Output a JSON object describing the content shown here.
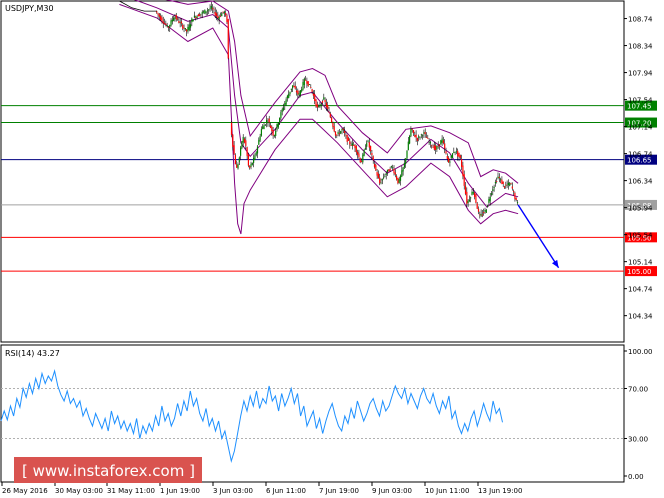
{
  "chart_data": [
    {
      "type": "candlestick",
      "title": "USDJPY,M30",
      "y_ticks": [
        "108.74",
        "108.34",
        "107.94",
        "107.54",
        "107.14",
        "106.74",
        "106.34",
        "105.94",
        "105.54",
        "105.14",
        "104.74",
        "104.34"
      ],
      "ylim": [
        103.95,
        109.0
      ],
      "x_ticks": [
        "26 May 2016",
        "30 May 03:00",
        "31 May 11:00",
        "1 Jun 19:00",
        "3 Jun 03:00",
        "6 Jun 11:00",
        "7 Jun 19:00",
        "9 Jun 03:00",
        "10 Jun 11:00",
        "13 Jun 19:00"
      ],
      "price_path": [
        [
          0.0,
          109.05
        ],
        [
          0.04,
          109.02
        ],
        [
          0.08,
          109.05
        ],
        [
          0.12,
          109.0
        ],
        [
          0.19,
          109.0
        ],
        [
          0.21,
          108.9
        ],
        [
          0.23,
          108.85
        ],
        [
          0.25,
          108.85
        ],
        [
          0.27,
          108.6
        ],
        [
          0.28,
          108.78
        ],
        [
          0.3,
          108.55
        ],
        [
          0.31,
          108.75
        ],
        [
          0.33,
          108.85
        ],
        [
          0.34,
          108.9
        ],
        [
          0.35,
          108.75
        ],
        [
          0.36,
          108.85
        ],
        [
          0.365,
          108.7
        ],
        [
          0.37,
          107.2
        ],
        [
          0.375,
          106.8
        ],
        [
          0.38,
          106.5
        ],
        [
          0.385,
          106.7
        ],
        [
          0.39,
          107.0
        ],
        [
          0.395,
          106.85
        ],
        [
          0.4,
          106.5
        ],
        [
          0.41,
          106.7
        ],
        [
          0.42,
          107.1
        ],
        [
          0.43,
          107.25
        ],
        [
          0.44,
          107.0
        ],
        [
          0.45,
          107.3
        ],
        [
          0.46,
          107.55
        ],
        [
          0.47,
          107.75
        ],
        [
          0.48,
          107.6
        ],
        [
          0.49,
          107.85
        ],
        [
          0.5,
          107.7
        ],
        [
          0.51,
          107.4
        ],
        [
          0.52,
          107.55
        ],
        [
          0.53,
          107.3
        ],
        [
          0.54,
          107.0
        ],
        [
          0.55,
          107.1
        ],
        [
          0.56,
          106.9
        ],
        [
          0.57,
          106.85
        ],
        [
          0.58,
          106.6
        ],
        [
          0.59,
          106.95
        ],
        [
          0.6,
          106.6
        ],
        [
          0.61,
          106.3
        ],
        [
          0.62,
          106.45
        ],
        [
          0.63,
          106.55
        ],
        [
          0.64,
          106.3
        ],
        [
          0.65,
          106.6
        ],
        [
          0.66,
          107.1
        ],
        [
          0.67,
          106.95
        ],
        [
          0.68,
          107.05
        ],
        [
          0.69,
          106.9
        ],
        [
          0.7,
          106.8
        ],
        [
          0.71,
          106.95
        ],
        [
          0.72,
          106.6
        ],
        [
          0.73,
          106.8
        ],
        [
          0.74,
          106.65
        ],
        [
          0.75,
          106.0
        ],
        [
          0.76,
          106.2
        ],
        [
          0.77,
          105.8
        ],
        [
          0.78,
          105.9
        ],
        [
          0.79,
          106.2
        ],
        [
          0.8,
          106.4
        ],
        [
          0.81,
          106.25
        ],
        [
          0.82,
          106.3
        ],
        [
          0.83,
          106.0
        ]
      ],
      "bb_mid": [
        [
          0.19,
          109.1
        ],
        [
          0.25,
          108.9
        ],
        [
          0.3,
          108.7
        ],
        [
          0.34,
          108.8
        ],
        [
          0.365,
          108.6
        ],
        [
          0.375,
          107.6
        ],
        [
          0.385,
          106.9
        ],
        [
          0.4,
          106.7
        ],
        [
          0.44,
          107.1
        ],
        [
          0.48,
          107.6
        ],
        [
          0.5,
          107.65
        ],
        [
          0.54,
          107.2
        ],
        [
          0.58,
          106.8
        ],
        [
          0.62,
          106.45
        ],
        [
          0.65,
          106.6
        ],
        [
          0.69,
          106.95
        ],
        [
          0.72,
          106.75
        ],
        [
          0.75,
          106.3
        ],
        [
          0.78,
          105.95
        ],
        [
          0.81,
          106.15
        ],
        [
          0.83,
          106.1
        ]
      ],
      "bb_upper": [
        [
          0.19,
          109.2
        ],
        [
          0.25,
          109.05
        ],
        [
          0.3,
          108.95
        ],
        [
          0.34,
          109.0
        ],
        [
          0.365,
          108.85
        ],
        [
          0.375,
          108.4
        ],
        [
          0.385,
          107.6
        ],
        [
          0.4,
          107.0
        ],
        [
          0.44,
          107.5
        ],
        [
          0.48,
          107.95
        ],
        [
          0.5,
          108.0
        ],
        [
          0.52,
          107.9
        ],
        [
          0.54,
          107.45
        ],
        [
          0.58,
          107.05
        ],
        [
          0.62,
          106.75
        ],
        [
          0.65,
          107.1
        ],
        [
          0.69,
          107.15
        ],
        [
          0.72,
          107.05
        ],
        [
          0.75,
          106.9
        ],
        [
          0.77,
          106.4
        ],
        [
          0.79,
          106.5
        ],
        [
          0.81,
          106.45
        ],
        [
          0.83,
          106.3
        ]
      ],
      "bb_lower": [
        [
          0.19,
          108.95
        ],
        [
          0.25,
          108.75
        ],
        [
          0.3,
          108.4
        ],
        [
          0.34,
          108.6
        ],
        [
          0.365,
          108.2
        ],
        [
          0.375,
          106.3
        ],
        [
          0.38,
          105.7
        ],
        [
          0.385,
          105.55
        ],
        [
          0.39,
          106.0
        ],
        [
          0.4,
          106.2
        ],
        [
          0.44,
          106.8
        ],
        [
          0.48,
          107.25
        ],
        [
          0.5,
          107.25
        ],
        [
          0.54,
          106.9
        ],
        [
          0.58,
          106.5
        ],
        [
          0.62,
          106.1
        ],
        [
          0.65,
          106.25
        ],
        [
          0.69,
          106.6
        ],
        [
          0.72,
          106.4
        ],
        [
          0.75,
          105.9
        ],
        [
          0.77,
          105.7
        ],
        [
          0.79,
          105.85
        ],
        [
          0.81,
          105.9
        ],
        [
          0.83,
          105.85
        ]
      ],
      "levels": [
        {
          "price": 107.45,
          "label": "107.45",
          "color": "#008000"
        },
        {
          "price": 107.2,
          "label": "107.20",
          "color": "#008000"
        },
        {
          "price": 106.65,
          "label": "106.65",
          "color": "#000080"
        },
        {
          "price": 105.98,
          "label": "105.98",
          "color": "#a0a0a0"
        },
        {
          "price": 105.5,
          "label": "105.50",
          "color": "#ff0000"
        },
        {
          "price": 105.0,
          "label": "105.00",
          "color": "#ff0000"
        }
      ],
      "arrow": {
        "from": [
          0.83,
          105.98
        ],
        "to": [
          0.895,
          105.05
        ],
        "color": "#0000ff"
      }
    },
    {
      "type": "line",
      "title": "RSI(14) 43.27",
      "y_ticks": [
        "100.00",
        "70.00",
        "30.00",
        "0.00"
      ],
      "ylim": [
        0,
        100
      ],
      "reference_levels": [
        70,
        30
      ],
      "series": [
        {
          "values": [
            44,
            52,
            45,
            56,
            48,
            62,
            55,
            70,
            63,
            74,
            66,
            78,
            70,
            82,
            74,
            80,
            76,
            84,
            72,
            65,
            60,
            68,
            58,
            62,
            55,
            60,
            48,
            54,
            46,
            40,
            50,
            44,
            38,
            46,
            36,
            52,
            42,
            48,
            38,
            44,
            36,
            42,
            34,
            46,
            30,
            40,
            34,
            42,
            36,
            48,
            40,
            56,
            44,
            50,
            40,
            46,
            58,
            48,
            60,
            52,
            68,
            56,
            62,
            50,
            44,
            54,
            40,
            46,
            36,
            44,
            30,
            36,
            24,
            12,
            20,
            34,
            48,
            60,
            52,
            64,
            56,
            68,
            54,
            62,
            58,
            72,
            60,
            64,
            52,
            66,
            56,
            62,
            70,
            58,
            66,
            48,
            56,
            40,
            46,
            52,
            38,
            46,
            34,
            44,
            52,
            58,
            48,
            40,
            36,
            48,
            42,
            54,
            46,
            60,
            52,
            44,
            50,
            58,
            62,
            54,
            48,
            60,
            52,
            56,
            64,
            72,
            66,
            62,
            70,
            58,
            66,
            60,
            54,
            64,
            70,
            62,
            58,
            66,
            56,
            50,
            60,
            54,
            64,
            46,
            52,
            40,
            34,
            42,
            36,
            46,
            52,
            40,
            48,
            58,
            50,
            44,
            60,
            50,
            54,
            43
          ]
        }
      ]
    }
  ],
  "watermark": {
    "text": "[ www.instaforex.com ]",
    "bg": "#d9534f"
  }
}
